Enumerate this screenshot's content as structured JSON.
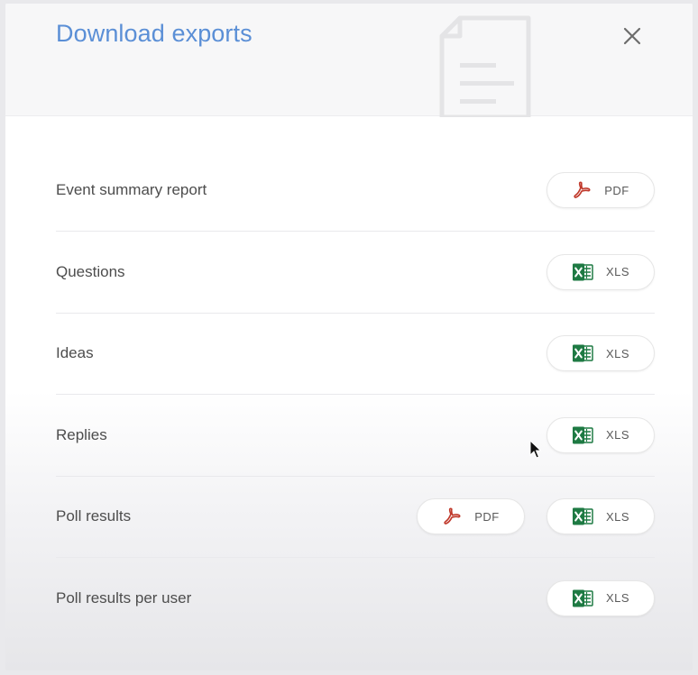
{
  "dialog": {
    "title": "Download exports",
    "close_label": "×"
  },
  "exports": [
    {
      "label": "Event summary report",
      "buttons": [
        {
          "type": "pdf",
          "label": "PDF"
        }
      ]
    },
    {
      "label": "Questions",
      "buttons": [
        {
          "type": "xls",
          "label": "XLS"
        }
      ]
    },
    {
      "label": "Ideas",
      "buttons": [
        {
          "type": "xls",
          "label": "XLS"
        }
      ]
    },
    {
      "label": "Replies",
      "buttons": [
        {
          "type": "xls",
          "label": "XLS"
        }
      ]
    },
    {
      "label": "Poll results",
      "buttons": [
        {
          "type": "pdf",
          "label": "PDF"
        },
        {
          "type": "xls",
          "label": "XLS"
        }
      ]
    },
    {
      "label": "Poll results per user",
      "buttons": [
        {
          "type": "xls",
          "label": "XLS"
        }
      ]
    }
  ],
  "icons": {
    "pdf": "pdf-icon",
    "xls": "excel-icon",
    "header": "document-icon",
    "close": "close-icon"
  },
  "colors": {
    "title": "#5b8fd6",
    "pdf_icon": "#c0392b",
    "xls_icon": "#1e7a43",
    "text": "#4d4d4d"
  }
}
